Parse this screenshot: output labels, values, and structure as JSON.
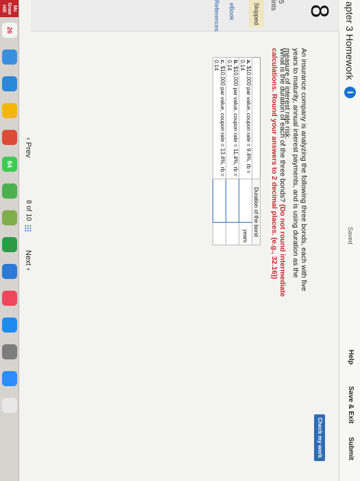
{
  "header": {
    "chapter_title": "apter 3 Homework",
    "info_icon": "i",
    "saved_label": "Saved",
    "help_label": "Help",
    "save_exit_label": "Save & Exit",
    "submit_label": "Submit"
  },
  "sidebar": {
    "question_number": "8",
    "points_text": "5\nints",
    "skipped_badge": "Skipped",
    "ebook_link": "eBook",
    "references_link": "References"
  },
  "main": {
    "check_button": "Check my work",
    "question_intro": "An insurance company is analyzing the following three bonds, each with five years to maturity, annual interest payments, and is using duration as the measure of interest rate risk.",
    "question_ask": "What is the duration of each of the three bonds?",
    "question_instructions": "(Do not round intermediate calculations. Round your answers to 2 decimal places. (e.g., 32.16))",
    "table": {
      "header": "Duration of the bond",
      "rows": [
        {
          "label": "a.",
          "desc": "$10,000 par value, coupon rate = 9.4%, rb = 0.14",
          "value": "",
          "unit": "years"
        },
        {
          "label": "b.",
          "desc": "$10,000 par value, coupon rate = 11.4%, rb = 0.14",
          "value": "",
          "unit": ""
        },
        {
          "label": "c.",
          "desc": "$10,000 par value, coupon rate = 13.4%, rb = 0.14",
          "value": "",
          "unit": ""
        }
      ]
    }
  },
  "pager": {
    "prev_label": "Prev",
    "position": "8 of 10",
    "next_label": "Next"
  },
  "dock": {
    "brand_label": "Mc Graw Hill",
    "date_badge": "26",
    "badge_count": "84",
    "icons": [
      "finder-icon",
      "launchpad-icon",
      "safari-icon",
      "chrome-icon",
      "photos-icon",
      "messages-icon",
      "facetime-icon",
      "maps-icon",
      "notes-icon",
      "reminders-icon",
      "numbers-icon",
      "keynote-icon",
      "music-icon",
      "app-store-icon",
      "system-preferences-icon",
      "zoom-icon"
    ],
    "colors": {
      "finder": "#3b8fdf",
      "chrome": "#dd4b39",
      "safari": "#2a88d8",
      "messages": "#3ecb52",
      "music": "#f0465b",
      "zoom": "#2d8cff"
    }
  }
}
